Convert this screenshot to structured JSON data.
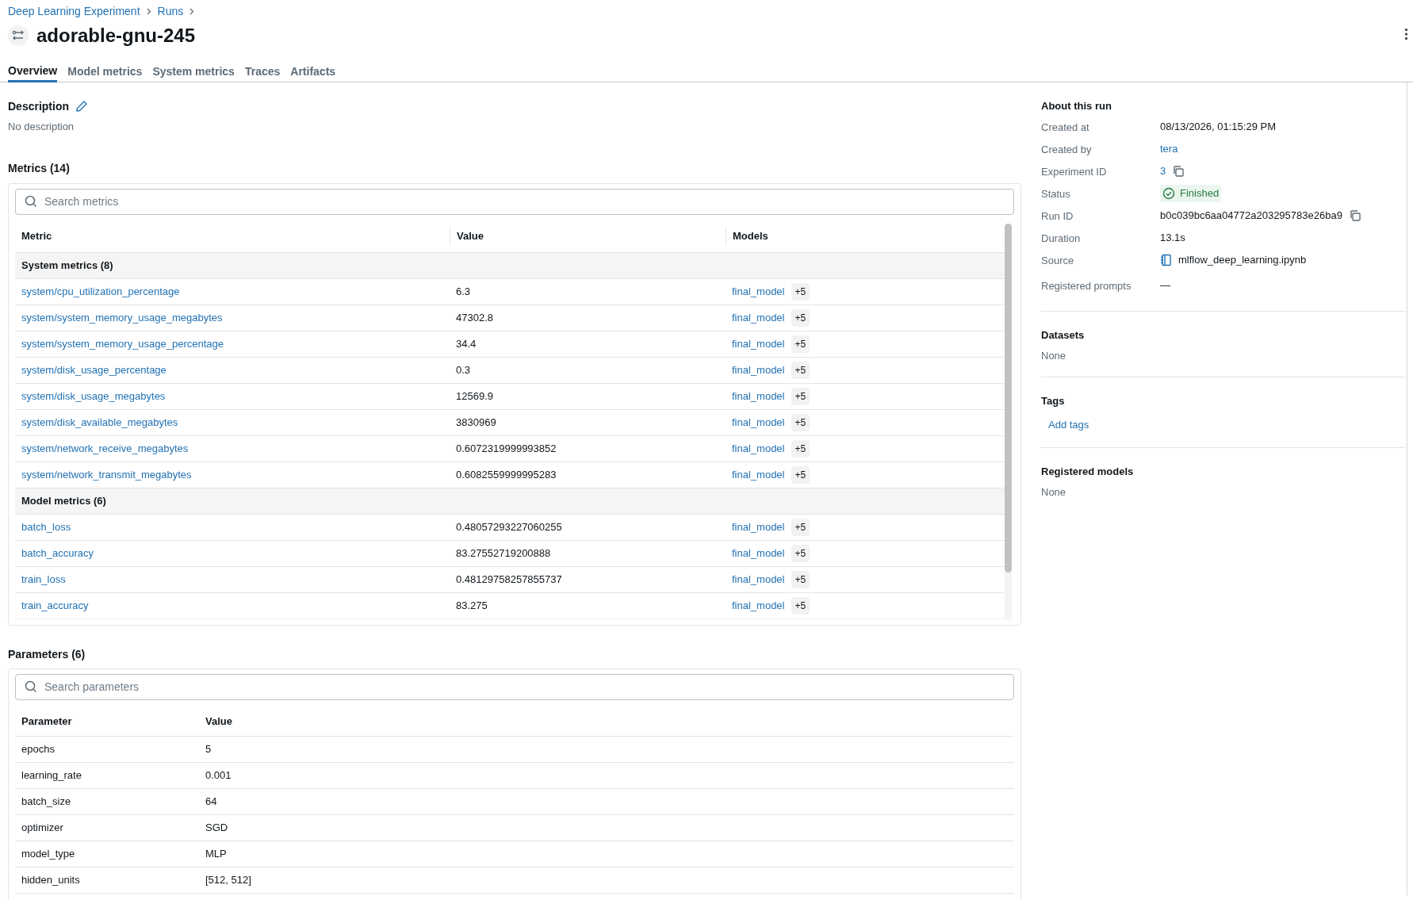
{
  "breadcrumb": [
    "Deep Learning Experiment",
    "Runs"
  ],
  "title": "adorable-gnu-245",
  "tabs": [
    {
      "label": "Overview",
      "selected": true
    },
    {
      "label": "Model metrics",
      "selected": false
    },
    {
      "label": "System metrics",
      "selected": false
    },
    {
      "label": "Traces",
      "selected": false
    },
    {
      "label": "Artifacts",
      "selected": false
    }
  ],
  "description": {
    "heading": "Description",
    "text": "No description"
  },
  "metrics": {
    "heading": "Metrics (14)",
    "search": {
      "placeholder": "Search metrics"
    },
    "columns": [
      "Metric",
      "Value",
      "Models"
    ],
    "groups": [
      {
        "label": "System metrics (8)",
        "rows": [
          {
            "metric": "system/cpu_utilization_percentage",
            "value": "6.3",
            "model": "final_model",
            "more": "+5"
          },
          {
            "metric": "system/system_memory_usage_megabytes",
            "value": "47302.8",
            "model": "final_model",
            "more": "+5"
          },
          {
            "metric": "system/system_memory_usage_percentage",
            "value": "34.4",
            "model": "final_model",
            "more": "+5"
          },
          {
            "metric": "system/disk_usage_percentage",
            "value": "0.3",
            "model": "final_model",
            "more": "+5"
          },
          {
            "metric": "system/disk_usage_megabytes",
            "value": "12569.9",
            "model": "final_model",
            "more": "+5"
          },
          {
            "metric": "system/disk_available_megabytes",
            "value": "3830969",
            "model": "final_model",
            "more": "+5"
          },
          {
            "metric": "system/network_receive_megabytes",
            "value": "0.6072319999993852",
            "model": "final_model",
            "more": "+5"
          },
          {
            "metric": "system/network_transmit_megabytes",
            "value": "0.6082559999995283",
            "model": "final_model",
            "more": "+5"
          }
        ]
      },
      {
        "label": "Model metrics (6)",
        "rows": [
          {
            "metric": "batch_loss",
            "value": "0.48057293227060255",
            "model": "final_model",
            "more": "+5"
          },
          {
            "metric": "batch_accuracy",
            "value": "83.27552719200888",
            "model": "final_model",
            "more": "+5"
          },
          {
            "metric": "train_loss",
            "value": "0.48129758257855737",
            "model": "final_model",
            "more": "+5"
          },
          {
            "metric": "train_accuracy",
            "value": "83.275",
            "model": "final_model",
            "more": "+5"
          }
        ]
      }
    ]
  },
  "parameters": {
    "heading": "Parameters (6)",
    "search": {
      "placeholder": "Search parameters"
    },
    "columns": [
      "Parameter",
      "Value"
    ],
    "rows": [
      [
        "epochs",
        "5"
      ],
      [
        "learning_rate",
        "0.001"
      ],
      [
        "batch_size",
        "64"
      ],
      [
        "optimizer",
        "SGD"
      ],
      [
        "model_type",
        "MLP"
      ],
      [
        "hidden_units",
        "[512, 512]"
      ]
    ]
  },
  "about": {
    "heading": "About this run",
    "rows": [
      {
        "label": "Created at",
        "value": "08/13/2026, 01:15:29 PM",
        "kind": "text"
      },
      {
        "label": "Created by",
        "value": "tera",
        "kind": "link"
      },
      {
        "label": "Experiment ID",
        "value": "3",
        "kind": "link-copy"
      },
      {
        "label": "Status",
        "value": "Finished",
        "kind": "status"
      },
      {
        "label": "Run ID",
        "value": "b0c039bc6aa04772a203295783e26ba9",
        "kind": "copy"
      },
      {
        "label": "Duration",
        "value": "13.1s",
        "kind": "text"
      },
      {
        "label": "Source",
        "value": "mlflow_deep_learning.ipynb",
        "kind": "notebook"
      },
      {
        "label": "Registered prompts",
        "value": "—",
        "kind": "text"
      }
    ]
  },
  "datasets": {
    "heading": "Datasets",
    "text": "None"
  },
  "tags": {
    "heading": "Tags",
    "action": "Add tags"
  },
  "registered_models": {
    "heading": "Registered models",
    "text": "None"
  }
}
